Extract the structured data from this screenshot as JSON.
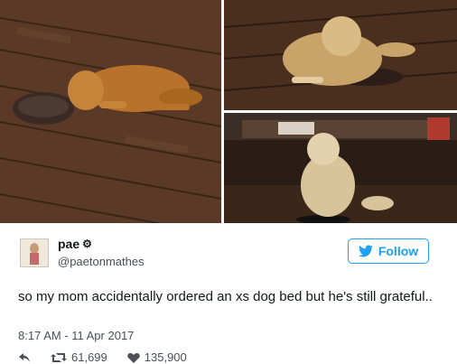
{
  "tweet": {
    "display_name": "pae",
    "verified_icon": "gear-badge-icon",
    "handle": "@paetonmathes",
    "text": "so my mom accidentally ordered an xs dog bed but he's still grateful..",
    "timestamp": "8:17 AM - 11 Apr 2017",
    "follow_label": "Follow",
    "retweets": "61,699",
    "likes": "135,900"
  },
  "icons": {
    "reply": "reply-icon",
    "retweet": "retweet-icon",
    "like": "heart-icon",
    "twitter": "twitter-bird-icon"
  },
  "colors": {
    "accent": "#1da1f2",
    "text": "#14171a",
    "muted": "#4a5056"
  }
}
